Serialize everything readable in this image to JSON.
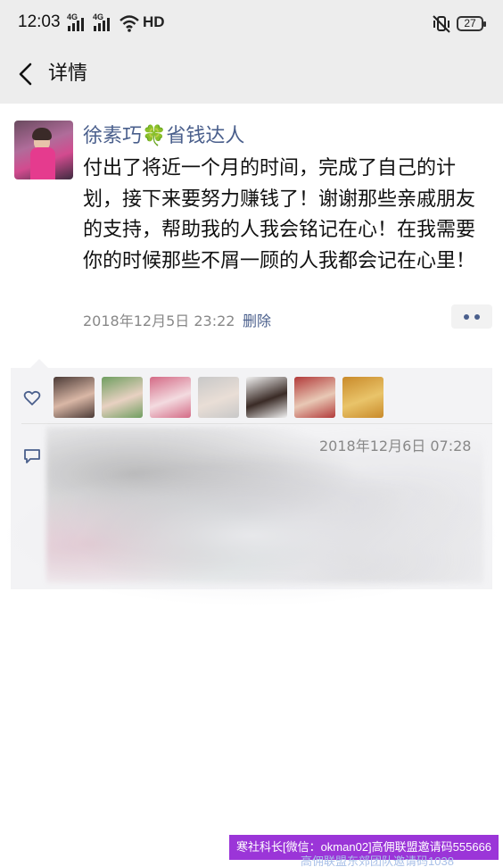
{
  "status_bar": {
    "time": "12:03",
    "signal_1": "4G",
    "signal_2": "4G",
    "hd": "HD",
    "battery": "27"
  },
  "nav": {
    "title": "详情"
  },
  "post": {
    "username": "徐素巧🍀省钱达人",
    "text": "付出了将近一个月的时间，完成了自己的计划，接下来要努力赚钱了！谢谢那些亲戚朋友的支持，帮助我的人我会铭记在心！在我需要你的时候那些不屑一顾的人我都会记在心里！",
    "timestamp": "2018年12月5日 23:22",
    "delete_label": "删除"
  },
  "comments": {
    "time": "2018年12月6日 07:28"
  },
  "likers": [
    {
      "colors": [
        "#4b3a36",
        "#d9b7a6"
      ]
    },
    {
      "colors": [
        "#6f9e60",
        "#e8d1c2"
      ]
    },
    {
      "colors": [
        "#d46a86",
        "#f3dbe0"
      ]
    },
    {
      "colors": [
        "#c8c8c8",
        "#e9ded6"
      ]
    },
    {
      "colors": [
        "#f1f1f1",
        "#3a2b26"
      ]
    },
    {
      "colors": [
        "#b23a3a",
        "#e8c8b5"
      ]
    },
    {
      "colors": [
        "#c98a2a",
        "#e9c46a"
      ]
    }
  ],
  "watermark": {
    "banner": "寒社科长[微信：okman02]高佣联盟邀请码555666",
    "banner_under": "高佣联盟东郊团队邀请码1038"
  },
  "colors": {
    "link": "#4a5f8c",
    "bar_bg": "#ededed",
    "banner_bg": "#9b35d8"
  }
}
